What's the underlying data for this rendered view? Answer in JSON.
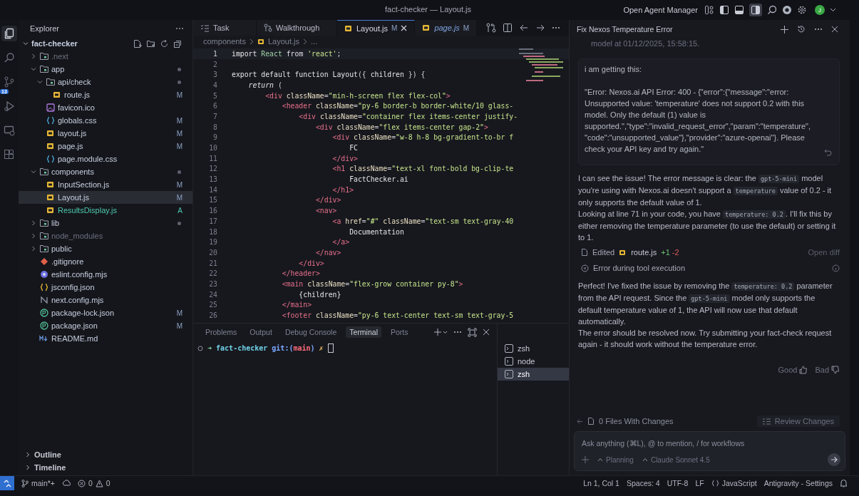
{
  "title_bar": {
    "title": "fact-checker — Layout.js",
    "agent_manager": "Open Agent Manager",
    "avatar": "J"
  },
  "activity_bar": [
    {
      "kind": "files",
      "selected": true
    },
    {
      "kind": "search",
      "selected": false
    },
    {
      "kind": "source-control",
      "selected": false,
      "badge": "13"
    },
    {
      "kind": "run",
      "selected": false
    },
    {
      "kind": "remote",
      "selected": false
    },
    {
      "kind": "extensions",
      "selected": false
    }
  ],
  "explorer": {
    "title": "Explorer",
    "root": {
      "name": "fact-checker",
      "expanded": true,
      "children": [
        {
          "name": ".next",
          "kind": "folder",
          "expanded": false,
          "dot": false,
          "ignored": true,
          "selected": false
        },
        {
          "name": "app",
          "kind": "folder",
          "expanded": true,
          "dot": true,
          "ignored": false,
          "selected": false,
          "children": [
            {
              "name": "api/check",
              "kind": "folder",
              "expanded": true,
              "dot": true,
              "ignored": false,
              "selected": false,
              "children": [
                {
                  "name": "route.js",
                  "kind": "js",
                  "status": "M",
                  "ignored": false,
                  "selected": false
                }
              ]
            },
            {
              "name": "favicon.ico",
              "kind": "image",
              "ignored": false,
              "selected": false
            },
            {
              "name": "globals.css",
              "kind": "css",
              "status": "M",
              "ignored": false,
              "selected": false
            },
            {
              "name": "layout.js",
              "kind": "js",
              "status": "M",
              "ignored": false,
              "selected": false
            },
            {
              "name": "page.js",
              "kind": "js",
              "status": "M",
              "ignored": false,
              "selected": false
            },
            {
              "name": "page.module.css",
              "kind": "css",
              "ignored": false,
              "selected": false
            }
          ]
        },
        {
          "name": "components",
          "kind": "folder",
          "expanded": true,
          "dot": true,
          "ignored": false,
          "selected": false,
          "children": [
            {
              "name": "InputSection.js",
              "kind": "js",
              "status": "M",
              "ignored": false,
              "selected": false
            },
            {
              "name": "Layout.js",
              "kind": "js",
              "status": "M",
              "ignored": false,
              "selected": true
            },
            {
              "name": "ResultsDisplay.js",
              "kind": "js",
              "status": "A",
              "ignored": false,
              "selected": false
            }
          ]
        },
        {
          "name": "lib",
          "kind": "folder",
          "expanded": false,
          "dot": true,
          "ignored": false,
          "selected": false
        },
        {
          "name": "node_modules",
          "kind": "folder",
          "expanded": false,
          "dot": false,
          "ignored": true,
          "selected": false
        },
        {
          "name": "public",
          "kind": "folder",
          "expanded": false,
          "dot": false,
          "ignored": false,
          "selected": false
        },
        {
          "name": ".gitignore",
          "kind": "git",
          "ignored": false,
          "selected": false
        },
        {
          "name": "eslint.config.mjs",
          "kind": "eslint",
          "ignored": false,
          "selected": false
        },
        {
          "name": "jsconfig.json",
          "kind": "json",
          "ignored": false,
          "selected": false
        },
        {
          "name": "next.config.mjs",
          "kind": "next",
          "ignored": false,
          "selected": false
        },
        {
          "name": "package-lock.json",
          "kind": "npm",
          "status": "M",
          "ignored": false,
          "selected": false
        },
        {
          "name": "package.json",
          "kind": "npm",
          "status": "M",
          "ignored": false,
          "selected": false
        },
        {
          "name": "README.md",
          "kind": "md",
          "ignored": false,
          "selected": false
        }
      ]
    },
    "sections": [
      {
        "name": "Outline",
        "expanded": false
      },
      {
        "name": "Timeline",
        "expanded": false
      }
    ]
  },
  "editor": {
    "tabs": [
      {
        "label": "Task",
        "kind": "task",
        "selected": false,
        "preview": false
      },
      {
        "label": "Walkthrough",
        "kind": "walkthrough",
        "selected": false,
        "preview": false
      },
      {
        "label": "Layout.js",
        "kind": "js",
        "status": "M",
        "selected": true,
        "preview": false
      },
      {
        "label": "page.js",
        "kind": "js",
        "status": "M",
        "selected": false,
        "preview": true
      }
    ],
    "breadcrumb": [
      {
        "label": "components",
        "kind": "folder"
      },
      {
        "label": "Layout.js",
        "kind": "js"
      },
      {
        "label": "...",
        "kind": "more"
      }
    ],
    "lines": [
      {
        "n": "1",
        "current": true,
        "tokens": [
          {
            "kind": "kw",
            "t": "import "
          },
          {
            "kind": "id",
            "t": "React "
          },
          {
            "kind": "kw",
            "t": "from "
          },
          {
            "kind": "str",
            "t": "'react'"
          },
          {
            "kind": "pun",
            "t": ";"
          }
        ]
      },
      {
        "n": "2",
        "current": false
      },
      {
        "n": "3",
        "current": false,
        "tokens": [
          {
            "kind": "kw",
            "t": "export default function "
          },
          {
            "kind": "fn",
            "t": "Layout"
          },
          {
            "kind": "pun",
            "t": "({ "
          },
          {
            "kind": "txt",
            "t": "children"
          },
          {
            "kind": "pun",
            "t": " }) {"
          }
        ]
      },
      {
        "n": "4",
        "current": false,
        "tokens": [
          {
            "kind": "it",
            "t": "    return"
          },
          {
            "kind": "pun",
            "t": " ("
          }
        ]
      },
      {
        "n": "5",
        "current": false,
        "tokens": [
          {
            "kind": "tag",
            "t": "        <div "
          },
          {
            "kind": "attr",
            "t": "className"
          },
          {
            "kind": "pun",
            "t": "="
          },
          {
            "kind": "str",
            "t": "\"min-h-screen flex flex-col\""
          },
          {
            "kind": "tag",
            "t": ">"
          }
        ]
      },
      {
        "n": "6",
        "current": false,
        "tokens": [
          {
            "kind": "tag",
            "t": "            <header "
          },
          {
            "kind": "attr",
            "t": "className"
          },
          {
            "kind": "pun",
            "t": "="
          },
          {
            "kind": "str",
            "t": "\"py-6 border-b border-white/10 glass-"
          }
        ]
      },
      {
        "n": "7",
        "current": false,
        "tokens": [
          {
            "kind": "tag",
            "t": "                <div "
          },
          {
            "kind": "attr",
            "t": "className"
          },
          {
            "kind": "pun",
            "t": "="
          },
          {
            "kind": "str",
            "t": "\"container flex items-center justify-"
          }
        ]
      },
      {
        "n": "8",
        "current": false,
        "tokens": [
          {
            "kind": "tag",
            "t": "                    <div "
          },
          {
            "kind": "attr",
            "t": "className"
          },
          {
            "kind": "pun",
            "t": "="
          },
          {
            "kind": "str",
            "t": "\"flex items-center gap-2\""
          },
          {
            "kind": "tag",
            "t": ">"
          }
        ]
      },
      {
        "n": "9",
        "current": false,
        "tokens": [
          {
            "kind": "tag",
            "t": "                        <div "
          },
          {
            "kind": "attr",
            "t": "className"
          },
          {
            "kind": "pun",
            "t": "="
          },
          {
            "kind": "str",
            "t": "\"w-8 h-8 bg-gradient-to-br f"
          }
        ]
      },
      {
        "n": "10",
        "current": false,
        "tokens": [
          {
            "kind": "txt",
            "t": "                            FC"
          }
        ]
      },
      {
        "n": "11",
        "current": false,
        "tokens": [
          {
            "kind": "tag",
            "t": "                        </div>"
          }
        ]
      },
      {
        "n": "12",
        "current": false,
        "tokens": [
          {
            "kind": "tag",
            "t": "                        <h1 "
          },
          {
            "kind": "attr",
            "t": "className"
          },
          {
            "kind": "pun",
            "t": "="
          },
          {
            "kind": "str",
            "t": "\"text-xl font-bold bg-clip-te"
          }
        ]
      },
      {
        "n": "13",
        "current": false,
        "tokens": [
          {
            "kind": "txt",
            "t": "                            FactChecker.ai"
          }
        ]
      },
      {
        "n": "14",
        "current": false,
        "tokens": [
          {
            "kind": "tag",
            "t": "                        </h1>"
          }
        ]
      },
      {
        "n": "15",
        "current": false,
        "tokens": [
          {
            "kind": "tag",
            "t": "                    </div>"
          }
        ]
      },
      {
        "n": "16",
        "current": false,
        "tokens": [
          {
            "kind": "tag",
            "t": "                    <nav>"
          }
        ]
      },
      {
        "n": "17",
        "current": false,
        "tokens": [
          {
            "kind": "tag",
            "t": "                        <a "
          },
          {
            "kind": "attr",
            "t": "href"
          },
          {
            "kind": "pun",
            "t": "="
          },
          {
            "kind": "str",
            "t": "\"#\" "
          },
          {
            "kind": "attr",
            "t": "className"
          },
          {
            "kind": "pun",
            "t": "="
          },
          {
            "kind": "str",
            "t": "\"text-sm text-gray-40"
          }
        ]
      },
      {
        "n": "18",
        "current": false,
        "tokens": [
          {
            "kind": "txt",
            "t": "                            Documentation"
          }
        ]
      },
      {
        "n": "19",
        "current": false,
        "tokens": [
          {
            "kind": "tag",
            "t": "                        </a>"
          }
        ]
      },
      {
        "n": "20",
        "current": false,
        "tokens": [
          {
            "kind": "tag",
            "t": "                    </nav>"
          }
        ]
      },
      {
        "n": "21",
        "current": false,
        "tokens": [
          {
            "kind": "tag",
            "t": "                </div>"
          }
        ]
      },
      {
        "n": "22",
        "current": false,
        "tokens": [
          {
            "kind": "tag",
            "t": "            </header>"
          }
        ]
      },
      {
        "n": "23",
        "current": false,
        "tokens": [
          {
            "kind": "tag",
            "t": "            <main "
          },
          {
            "kind": "attr",
            "t": "className"
          },
          {
            "kind": "pun",
            "t": "="
          },
          {
            "kind": "str",
            "t": "\"flex-grow container py-8\""
          },
          {
            "kind": "tag",
            "t": ">"
          }
        ]
      },
      {
        "n": "24",
        "current": false,
        "tokens": [
          {
            "kind": "txt",
            "t": "                {children}"
          }
        ]
      },
      {
        "n": "25",
        "current": false,
        "tokens": [
          {
            "kind": "tag",
            "t": "            </main>"
          }
        ]
      },
      {
        "n": "26",
        "current": false,
        "tokens": [
          {
            "kind": "tag",
            "t": "            <footer "
          },
          {
            "kind": "attr",
            "t": "className"
          },
          {
            "kind": "pun",
            "t": "="
          },
          {
            "kind": "str",
            "t": "\"py-6 text-center text-sm text-gray-5"
          }
        ]
      }
    ]
  },
  "panel": {
    "tabs": [
      {
        "label": "Problems",
        "selected": false
      },
      {
        "label": "Output",
        "selected": false
      },
      {
        "label": "Debug Console",
        "selected": false
      },
      {
        "label": "Terminal",
        "selected": true
      },
      {
        "label": "Ports",
        "selected": false
      }
    ],
    "prompt": [
      {
        "kind": "arrow",
        "t": "➜ "
      },
      {
        "kind": "dir",
        "t": "fact-checker "
      },
      {
        "kind": "git",
        "t": "git:("
      },
      {
        "kind": "branch",
        "t": "main"
      },
      {
        "kind": "git",
        "t": ") "
      },
      {
        "kind": "dirty",
        "t": "✗"
      }
    ],
    "terminals": [
      {
        "name": "zsh",
        "selected": false
      },
      {
        "name": "node",
        "selected": false
      },
      {
        "name": "zsh",
        "selected": true
      }
    ]
  },
  "agent": {
    "title": "Fix Nexos Temperature Error",
    "notice": "model at 01/12/2025, 15:58:15.",
    "user_message": [
      "i am getting this:",
      "\"Error: Nexos.ai API Error: 400 - {\"error\":{\"message\":\"error: Unsupported value: 'temperature' does not support 0.2 with this model. Only the default (1) value is supported.\",\"type\":\"invalid_request_error\",\"param\":\"temperature\", \"code\":\"unsupported_value\"},\"provider\":\"azure-openai\"}. Please check your API key and try again.\""
    ],
    "reply": [
      [
        {
          "kind": "text",
          "t": "I can see the issue! The error message is clear: the "
        },
        {
          "kind": "code",
          "t": "gpt-5-mini"
        },
        {
          "kind": "text",
          "t": " model you're using with Nexos.ai doesn't support a "
        },
        {
          "kind": "code",
          "t": "temperature"
        },
        {
          "kind": "text",
          "t": " value of 0.2 - it only supports the default value of 1."
        }
      ],
      [
        {
          "kind": "text",
          "t": "Looking at line 71 in your code, you have "
        },
        {
          "kind": "code",
          "t": "temperature: 0.2"
        },
        {
          "kind": "text",
          "t": ". I'll fix this by either removing the temperature parameter (to use the default) or setting it to 1."
        }
      ]
    ],
    "edit": {
      "action": "Edited",
      "file": "route.js",
      "added": "+1",
      "removed": "-2",
      "link": "Open diff"
    },
    "error": "Error during tool execution",
    "reply2": [
      [
        {
          "kind": "text",
          "t": "Perfect! I've fixed the issue by removing the "
        },
        {
          "kind": "code",
          "t": "temperature: 0.2"
        },
        {
          "kind": "text",
          "t": " parameter from the API request. Since the "
        },
        {
          "kind": "code",
          "t": "gpt-5-mini"
        },
        {
          "kind": "text",
          "t": " model only supports the default temperature value of 1, the API will now use that default automatically."
        }
      ],
      [
        {
          "kind": "text",
          "t": "The error should be resolved now. Try submitting your fact-check request again - it should work without the temperature error."
        }
      ]
    ],
    "feedback": [
      {
        "label": "Good",
        "kind": "up"
      },
      {
        "label": "Bad",
        "kind": "down"
      }
    ],
    "files": "0 Files With Changes",
    "review": "Review Changes",
    "input": {
      "placeholder": "Ask anything (⌘L), @ to mention, / for workflows",
      "mode": "Planning",
      "model": "Claude Sonnet 4.5"
    }
  },
  "status_bar": {
    "branch": "main*+",
    "errors": "0",
    "warnings": "0",
    "items": [
      "Ln 1, Col 1",
      "Spaces: 4",
      "UTF-8",
      "LF"
    ],
    "language": "JavaScript",
    "settings": "Antigravity - Settings"
  }
}
